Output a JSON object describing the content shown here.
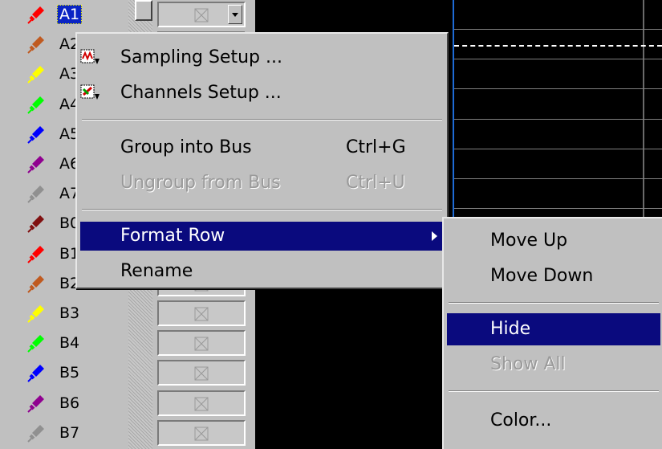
{
  "channels": [
    {
      "label": "A1",
      "color": "#ff0000",
      "selected": true
    },
    {
      "label": "A2",
      "color": "#c05a20"
    },
    {
      "label": "A3",
      "color": "#ffff00"
    },
    {
      "label": "A4",
      "color": "#00ff00"
    },
    {
      "label": "A5",
      "color": "#0000ff"
    },
    {
      "label": "A6",
      "color": "#900090"
    },
    {
      "label": "A7",
      "color": "#909090"
    },
    {
      "label": "B0",
      "color": "#801010"
    },
    {
      "label": "B1",
      "color": "#ff0000"
    },
    {
      "label": "B2",
      "color": "#c05a20"
    },
    {
      "label": "B3",
      "color": "#ffff00"
    },
    {
      "label": "B4",
      "color": "#00ff00"
    },
    {
      "label": "B5",
      "color": "#0000ff"
    },
    {
      "label": "B6",
      "color": "#900090"
    },
    {
      "label": "B7",
      "color": "#909090"
    }
  ],
  "context_menu": {
    "sampling_setup": "Sampling Setup ...",
    "channels_setup": "Channels Setup ...",
    "group_into_bus": "Group into Bus",
    "group_into_bus_shortcut": "Ctrl+G",
    "ungroup_from_bus": "Ungroup from Bus",
    "ungroup_from_bus_shortcut": "Ctrl+U",
    "format_row": "Format Row",
    "rename": "Rename"
  },
  "format_row_submenu": {
    "move_up": "Move Up",
    "move_down": "Move Down",
    "hide": "Hide",
    "show_all": "Show All",
    "color": "Color..."
  },
  "colors": {
    "highlight": "#0a0a7e",
    "selection": "#0a24c4",
    "cursor_line": "#1e6bd6",
    "waveform_bg": "#000000"
  }
}
